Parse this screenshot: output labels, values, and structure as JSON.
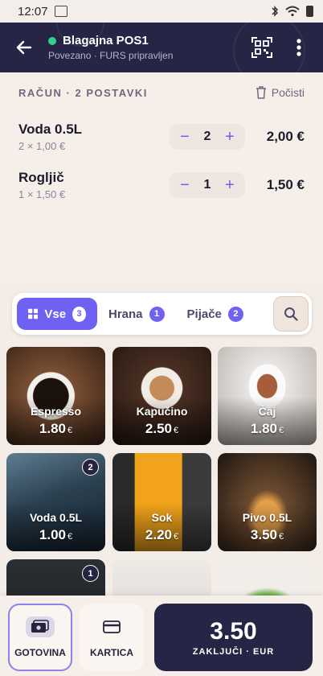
{
  "status_bar": {
    "time": "12:07"
  },
  "header": {
    "title": "Blagajna POS1",
    "subtitle": "Povezano · FURS pripravljen",
    "status_color": "#2fd08a"
  },
  "receipt": {
    "heading": "RAČUN · 2 POSTAVKI",
    "clear_label": "Počisti",
    "items": [
      {
        "name": "Voda 0.5L",
        "detail": "2 × 1,00 €",
        "qty": "2",
        "total": "2,00 €"
      },
      {
        "name": "Rogljič",
        "detail": "1 × 1,50 €",
        "qty": "1",
        "total": "1,50 €"
      }
    ]
  },
  "tabs": [
    {
      "label": "Vse",
      "count": "3",
      "active": true
    },
    {
      "label": "Hrana",
      "count": "1",
      "active": false
    },
    {
      "label": "Pijače",
      "count": "2",
      "active": false
    }
  ],
  "products": [
    {
      "name": "Espresso",
      "price": "1.80",
      "currency": "€",
      "badge": ""
    },
    {
      "name": "Kapučino",
      "price": "2.50",
      "currency": "€",
      "badge": ""
    },
    {
      "name": "Čaj",
      "price": "1.80",
      "currency": "€",
      "badge": ""
    },
    {
      "name": "Voda 0.5L",
      "price": "1.00",
      "currency": "€",
      "badge": "2"
    },
    {
      "name": "Sok",
      "price": "2.20",
      "currency": "€",
      "badge": ""
    },
    {
      "name": "Pivo 0.5L",
      "price": "3.50",
      "currency": "€",
      "badge": ""
    },
    {
      "name": "",
      "price": "",
      "currency": "",
      "badge": "1"
    },
    {
      "name": "",
      "price": "",
      "currency": "",
      "badge": ""
    },
    {
      "name": "",
      "price": "",
      "currency": "",
      "badge": ""
    }
  ],
  "payment": {
    "cash_label": "GOTOVINA",
    "card_label": "KARTICA",
    "total": "3.50",
    "checkout_label": "ZAKLJUČI · EUR"
  },
  "colors": {
    "accent": "#6f61f2",
    "header_bg": "#272545"
  }
}
